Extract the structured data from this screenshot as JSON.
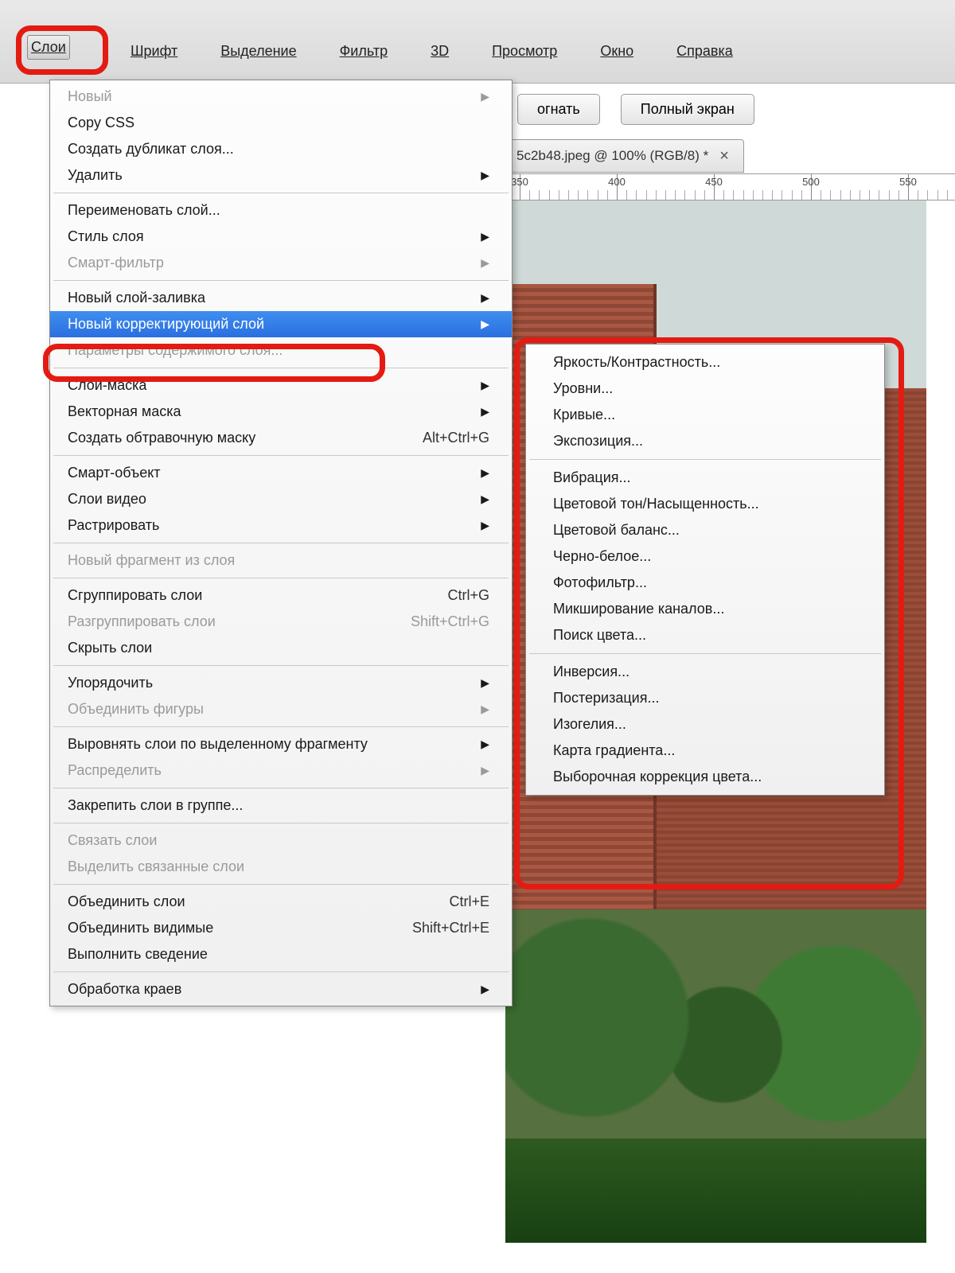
{
  "menubar": {
    "sloi": "Слои",
    "items": [
      "Шрифт",
      "Выделение",
      "Фильтр",
      "3D",
      "Просмотр",
      "Окно",
      "Справка"
    ]
  },
  "toolbar": {
    "fit": "огнать",
    "fullscreen": "Полный экран"
  },
  "doctab": {
    "title": "5c2b48.jpeg @ 100% (RGB/8) *",
    "close": "×"
  },
  "ruler": {
    "marks": [
      350,
      400,
      450,
      500,
      550
    ]
  },
  "menu": {
    "g0": [
      {
        "k": "new",
        "label": "Новый",
        "arrow": true,
        "disabled": true
      },
      {
        "k": "copycss",
        "label": "Copy CSS"
      },
      {
        "k": "dup",
        "label": "Создать дубликат слоя..."
      },
      {
        "k": "delete",
        "label": "Удалить",
        "arrow": true
      }
    ],
    "g1": [
      {
        "k": "rename",
        "label": "Переименовать слой..."
      },
      {
        "k": "style",
        "label": "Стиль слоя",
        "arrow": true
      },
      {
        "k": "smartfilter",
        "label": "Смарт-фильтр",
        "arrow": true,
        "disabled": true
      }
    ],
    "g2": [
      {
        "k": "fill",
        "label": "Новый слой-заливка",
        "arrow": true
      },
      {
        "k": "adj",
        "label": "Новый корректирующий слой",
        "arrow": true,
        "selected": true
      },
      {
        "k": "contentopts",
        "label": "Параметры содержимого слоя...",
        "disabled": true
      }
    ],
    "g3": [
      {
        "k": "mask",
        "label": "Слой-маска",
        "arrow": true
      },
      {
        "k": "vecmask",
        "label": "Векторная маска",
        "arrow": true
      },
      {
        "k": "clip",
        "label": "Создать обтравочную маску",
        "shortcut": "Alt+Ctrl+G"
      }
    ],
    "g4": [
      {
        "k": "smartobj",
        "label": "Смарт-объект",
        "arrow": true
      },
      {
        "k": "videolayers",
        "label": "Слои видео",
        "arrow": true
      },
      {
        "k": "raster",
        "label": "Растрировать",
        "arrow": true
      }
    ],
    "g5": [
      {
        "k": "slice",
        "label": "Новый фрагмент из слоя",
        "disabled": true
      }
    ],
    "g6": [
      {
        "k": "group",
        "label": "Сгруппировать слои",
        "shortcut": "Ctrl+G"
      },
      {
        "k": "ungroup",
        "label": "Разгруппировать слои",
        "shortcut": "Shift+Ctrl+G",
        "disabled": true
      },
      {
        "k": "hide",
        "label": "Скрыть слои"
      }
    ],
    "g7": [
      {
        "k": "arrange",
        "label": "Упорядочить",
        "arrow": true
      },
      {
        "k": "combine",
        "label": "Объединить фигуры",
        "arrow": true,
        "disabled": true
      }
    ],
    "g8": [
      {
        "k": "align",
        "label": "Выровнять слои по выделенному фрагменту",
        "arrow": true
      },
      {
        "k": "distribute",
        "label": "Распределить",
        "arrow": true,
        "disabled": true
      }
    ],
    "g9": [
      {
        "k": "lock",
        "label": "Закрепить слои в группе..."
      }
    ],
    "g10": [
      {
        "k": "link",
        "label": "Связать слои",
        "disabled": true
      },
      {
        "k": "sellinked",
        "label": "Выделить связанные слои",
        "disabled": true
      }
    ],
    "g11": [
      {
        "k": "merge",
        "label": "Объединить слои",
        "shortcut": "Ctrl+E"
      },
      {
        "k": "mergevis",
        "label": "Объединить видимые",
        "shortcut": "Shift+Ctrl+E"
      },
      {
        "k": "flatten",
        "label": "Выполнить сведение"
      }
    ],
    "g12": [
      {
        "k": "matting",
        "label": "Обработка краев",
        "arrow": true
      }
    ]
  },
  "submenu": {
    "s0": [
      "Яркость/Контрастность...",
      "Уровни...",
      "Кривые...",
      "Экспозиция..."
    ],
    "s1": [
      "Вибрация...",
      "Цветовой тон/Насыщенность...",
      "Цветовой баланс...",
      "Черно-белое...",
      "Фотофильтр...",
      "Микширование каналов...",
      "Поиск цвета..."
    ],
    "s2": [
      "Инверсия...",
      "Постеризация...",
      "Изогелия...",
      "Карта градиента...",
      "Выборочная коррекция цвета..."
    ]
  }
}
